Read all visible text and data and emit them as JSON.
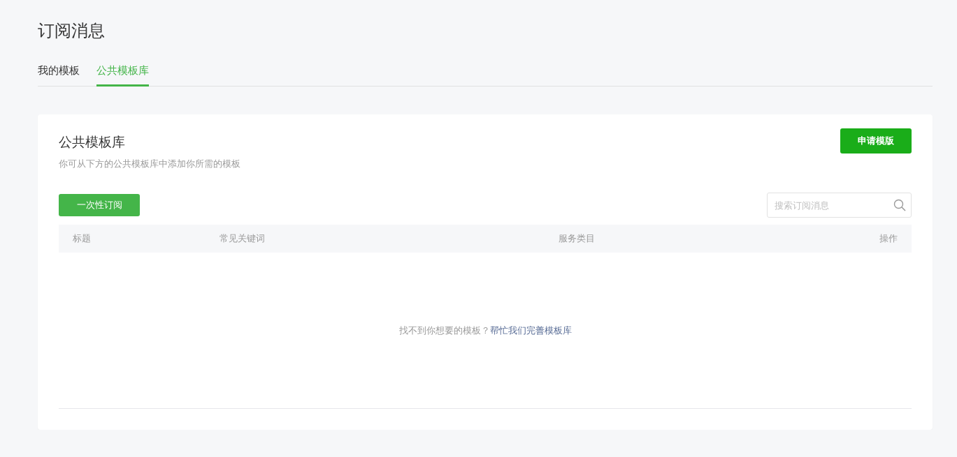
{
  "page": {
    "title": "订阅消息"
  },
  "tabs": [
    {
      "label": "我的模板",
      "selected": false
    },
    {
      "label": "公共模板库",
      "selected": true
    }
  ],
  "panel": {
    "title": "公共模板库",
    "description": "你可从下方的公共模板库中添加你所需的模板",
    "apply_button": "申请模版",
    "type_button": "一次性订阅",
    "search": {
      "placeholder": "搜索订阅消息"
    },
    "table": {
      "columns": [
        "标题",
        "常见关键词",
        "服务类目",
        "操作"
      ]
    },
    "empty": {
      "text": "找不到你想要的模板？",
      "link": "帮忙我们完善模板库"
    }
  }
}
